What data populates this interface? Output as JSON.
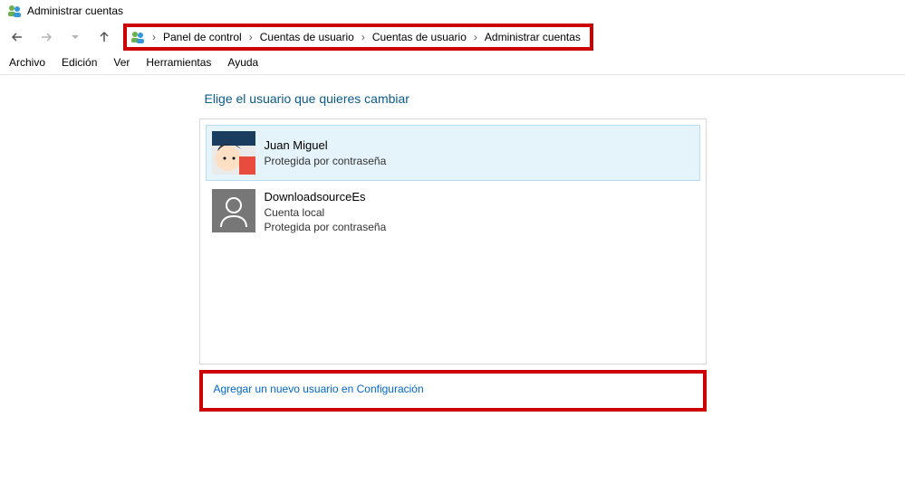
{
  "window": {
    "title": "Administrar cuentas"
  },
  "breadcrumb": {
    "items": [
      "Panel de control",
      "Cuentas de usuario",
      "Cuentas de usuario",
      "Administrar cuentas"
    ]
  },
  "menu": {
    "archivo": "Archivo",
    "edicion": "Edición",
    "ver": "Ver",
    "herramientas": "Herramientas",
    "ayuda": "Ayuda"
  },
  "heading": "Elige el usuario que quieres cambiar",
  "users": [
    {
      "name": "Juan Miguel",
      "line2": "",
      "line3": "Protegida por contraseña",
      "selected": true,
      "avatar_type": "cartoon"
    },
    {
      "name": "DownloadsourceEs",
      "line2": "Cuenta local",
      "line3": "Protegida por contraseña",
      "selected": false,
      "avatar_type": "grey"
    }
  ],
  "add_link": "Agregar un nuevo usuario en Configuración"
}
